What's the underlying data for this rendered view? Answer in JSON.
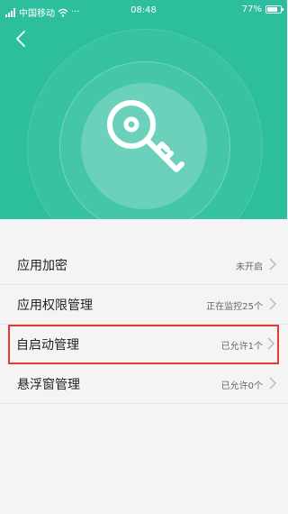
{
  "status_bar": {
    "carrier": "中国移动",
    "more": "···",
    "time": "08:48",
    "battery_percent": "77%",
    "battery_level": 0.77
  },
  "header": {
    "back_icon": "chevron-left-icon",
    "hero_icon": "key-icon",
    "accent": "#2dbf9d"
  },
  "list": {
    "items": [
      {
        "title": "应用加密",
        "value": "未开启"
      },
      {
        "title": "应用权限管理",
        "value": "正在监控25个"
      },
      {
        "title": "自启动管理",
        "value": "已允许1个"
      },
      {
        "title": "悬浮窗管理",
        "value": "已允许0个"
      }
    ]
  },
  "highlight_color": "#e53935"
}
